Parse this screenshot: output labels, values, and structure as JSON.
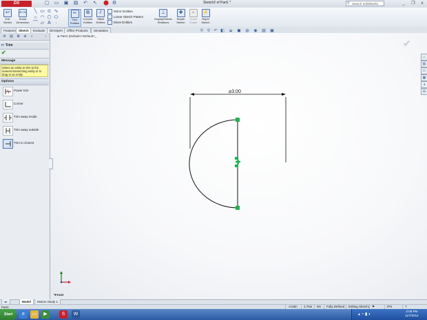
{
  "app": {
    "logo_text": "DS SOLIDWORKS",
    "document_title": "Sketch2 of Part1 *",
    "search_placeholder": "Search SolidWorks Help",
    "window_controls": [
      "_",
      "❐",
      "x"
    ]
  },
  "quick_access": [
    "new-icon",
    "open-icon",
    "save-icon",
    "print-icon",
    "undo-icon",
    "select-icon",
    "rebuild-icon",
    "options-icon"
  ],
  "ribbon": {
    "exit_sketch": "Exit Sketch",
    "smart_dimension": "Smart Dimension",
    "trim_entities": "Trim Entities",
    "convert_entities": "Convert Entities",
    "offset_entities": "Offset Entities",
    "mirror_entities": "Mirror Entities",
    "linear_sketch_pattern": "Linear Sketch Pattern",
    "move_entities": "Move Entities",
    "display_delete_relations": "Display/Delete Relations",
    "repair_sketch": "Repair Sketch",
    "quick_snaps": "Quick Snaps",
    "rapid_sketch": "Rapid Sketch"
  },
  "tabs": [
    "Features",
    "Sketch",
    "Evaluate",
    "DimXpert",
    "Office Products",
    "Simulation"
  ],
  "active_tab": "Sketch",
  "feature_tree": {
    "root_label": "Part1 (Default<<Default>_"
  },
  "property_manager": {
    "title": "Trim",
    "message_header": "Message",
    "message_text": "Select an entity to trim to the nearest intersecting entity or to drag to an entity",
    "options_header": "Options",
    "options": [
      {
        "label": "Power trim",
        "selected": false
      },
      {
        "label": "Corner",
        "selected": false
      },
      {
        "label": "Trim away inside",
        "selected": false
      },
      {
        "label": "Trim away outside",
        "selected": false
      },
      {
        "label": "Trim to closest",
        "selected": true
      }
    ]
  },
  "sketch": {
    "dimension_text": "⌀3.00",
    "view_label": "*Front"
  },
  "bottom_tabs": [
    "Model",
    "Motion Study 1"
  ],
  "active_bottom_tab": "Model",
  "status_bar": {
    "left": "Part1",
    "x": "-4.63in",
    "y": "2.76in",
    "z": "0in",
    "definition": "Fully Defined",
    "editing": "Editing Sketch2",
    "units": "IPS"
  },
  "taskbar": {
    "start_label": "Start",
    "clock_time": "2:06 PM",
    "clock_date": "11/7/2014"
  }
}
